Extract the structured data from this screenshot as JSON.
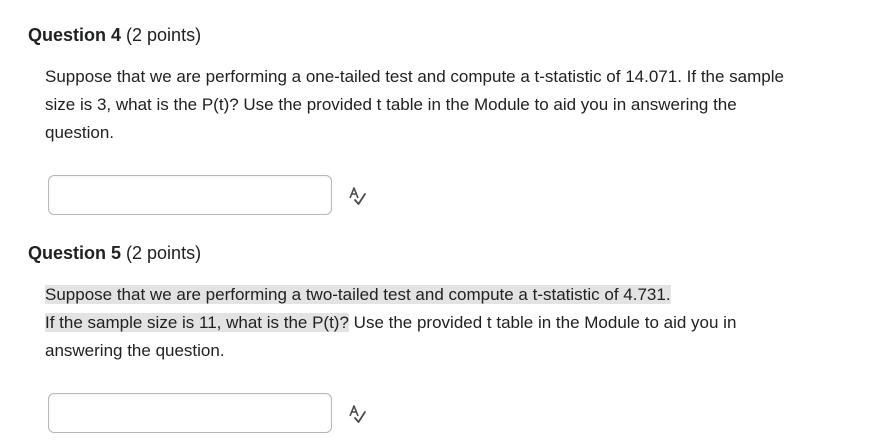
{
  "questions": [
    {
      "label": "Question 4",
      "points": "(2 points)",
      "text": "Suppose that we are performing a one-tailed test and compute a t-statistic of 14.071. If the sample size is 3, what is the P(t)? Use the provided t table in the Module to aid you in answering the question.",
      "answer_value": "",
      "icon": "spellcheck-icon"
    },
    {
      "label": "Question 5",
      "points": "(2 points)",
      "text_highlighted_1": "Suppose that we are performing a two-tailed test and compute a t-statistic of 4.731.",
      "text_highlighted_2": "If the sample size is 11, what is the P(t)?",
      "text_rest": " Use the provided t table in the Module to aid you in answering the question.",
      "answer_value": "",
      "icon": "spellcheck-icon"
    }
  ]
}
